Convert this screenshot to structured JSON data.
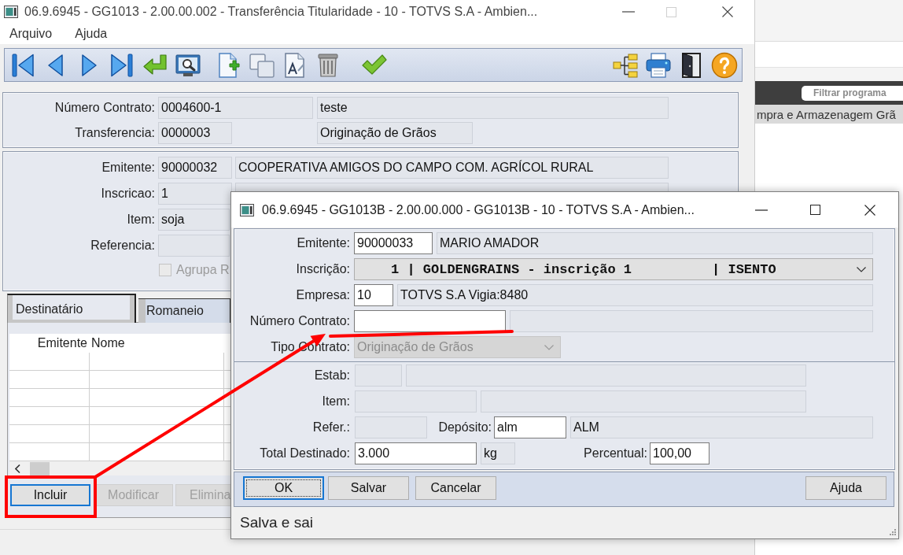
{
  "main_window": {
    "title": "06.9.6945 - GG1013 - 2.00.00.002 - Transferência Titularidade - 10 - TOTVS S.A - Ambien...",
    "controls": [
      {
        "kind": "minimize",
        "disabled": false
      },
      {
        "kind": "maximize",
        "disabled": true
      },
      {
        "kind": "close",
        "disabled": false
      }
    ],
    "menu": [
      {
        "label": "Arquivo"
      },
      {
        "label": "Ajuda"
      }
    ],
    "header_panel": {
      "rows": [
        {
          "label": "Número Contrato:",
          "fields": [
            {
              "kind": "readonly",
              "value": "0004600-1"
            },
            {
              "kind": "readonly",
              "value": "teste"
            }
          ]
        },
        {
          "label": "Transferencia:",
          "fields": [
            {
              "kind": "readonly",
              "value": "0000003"
            },
            {
              "kind": "readonly",
              "value": "Originação de Grãos"
            }
          ]
        }
      ]
    },
    "detail_panel": {
      "rows": [
        {
          "label": "Emitente:",
          "fields": [
            {
              "kind": "readonly",
              "value": "90000032"
            },
            {
              "kind": "readonly",
              "value": "COOPERATIVA AMIGOS DO CAMPO COM. AGRÍCOL RURAL"
            }
          ]
        },
        {
          "label": "Inscricao:",
          "fields": [
            {
              "kind": "readonly",
              "value": "1"
            },
            {
              "kind": "readonly"
            }
          ]
        },
        {
          "label": "Item:",
          "fields": [
            {
              "kind": "readonly",
              "value": "soja"
            }
          ]
        },
        {
          "label": "Referencia:",
          "fields": [
            {
              "kind": "readonly"
            }
          ]
        }
      ],
      "checkbox": {
        "label": "Agrupa R",
        "checked": false,
        "disabled": true
      }
    },
    "tabs": [
      {
        "label": "Destinatário",
        "selected": true
      },
      {
        "label": "Romaneio",
        "selected": false
      }
    ],
    "table": {
      "columns": [
        "Emitente",
        "Nome"
      ]
    },
    "buttons": [
      {
        "label": "Incluir",
        "focused": true,
        "disabled": false
      },
      {
        "label": "Modificar",
        "focused": false,
        "disabled": true
      },
      {
        "label": "Elimina",
        "focused": false,
        "disabled": true
      }
    ]
  },
  "dialog": {
    "title": "06.9.6945 - GG1013B - 2.00.00.000 - GG1013B - 10 - TOTVS S.A - Ambien...",
    "controls": [
      {
        "kind": "minimize",
        "disabled": false
      },
      {
        "kind": "maximize",
        "disabled": false
      },
      {
        "kind": "close",
        "disabled": false
      }
    ],
    "sections": [
      {
        "rows": [
          {
            "label": "Emitente:",
            "fields": [
              {
                "kind": "input",
                "value": "90000033"
              },
              {
                "kind": "readonly",
                "value": "MARIO AMADOR"
              }
            ]
          },
          {
            "label": "Inscrição:",
            "fields": [
              {
                "kind": "combo",
                "value": "1 | GOLDENGRAINS - inscrição 1          | ISENTO",
                "disabled": false
              }
            ]
          },
          {
            "label": "Empresa:",
            "fields": [
              {
                "kind": "input",
                "value": "10"
              },
              {
                "kind": "readonly",
                "value": "TOTVS S.A Vigia:8480"
              }
            ]
          },
          {
            "label": "Número Contrato:",
            "fields": [
              {
                "kind": "input"
              },
              {
                "kind": "readonly"
              }
            ]
          },
          {
            "label": "Tipo Contrato:",
            "fields": [
              {
                "kind": "combo",
                "value": "Originação de Grãos",
                "disabled": true
              }
            ]
          }
        ]
      },
      {
        "rows": [
          {
            "label": "Estab:",
            "fields": [
              {
                "kind": "readonly"
              },
              {
                "kind": "readonly"
              }
            ]
          },
          {
            "label": "Item:",
            "fields": [
              {
                "kind": "readonly"
              },
              {
                "kind": "readonly"
              }
            ]
          },
          {
            "label": "Refer.:",
            "fields": [
              {
                "kind": "readonly"
              },
              {
                "kind": "label",
                "text": "Depósito:"
              },
              {
                "kind": "input",
                "value": "alm"
              },
              {
                "kind": "readonly",
                "value": "ALM"
              }
            ]
          },
          {
            "label": "Total Destinado:",
            "fields": [
              {
                "kind": "input",
                "value": "3.000"
              },
              {
                "kind": "readonly",
                "value": "kg"
              },
              {
                "kind": "label",
                "text": "Percentual:"
              },
              {
                "kind": "input",
                "value": "100,00"
              }
            ]
          }
        ]
      }
    ],
    "buttons": [
      {
        "label": "OK",
        "focused": true
      },
      {
        "label": "Salvar",
        "focused": false
      },
      {
        "label": "Cancelar",
        "focused": false
      }
    ],
    "help_button": {
      "label": "Ajuda"
    },
    "status_bar": "Salva e sai"
  },
  "background_page": {
    "filter_field": {
      "placeholder": "Filtrar programa"
    },
    "heading": "mpra e Armazenagem Grã"
  },
  "callouts": [
    {
      "kind": "box"
    },
    {
      "kind": "arrow"
    },
    {
      "kind": "underline"
    }
  ]
}
